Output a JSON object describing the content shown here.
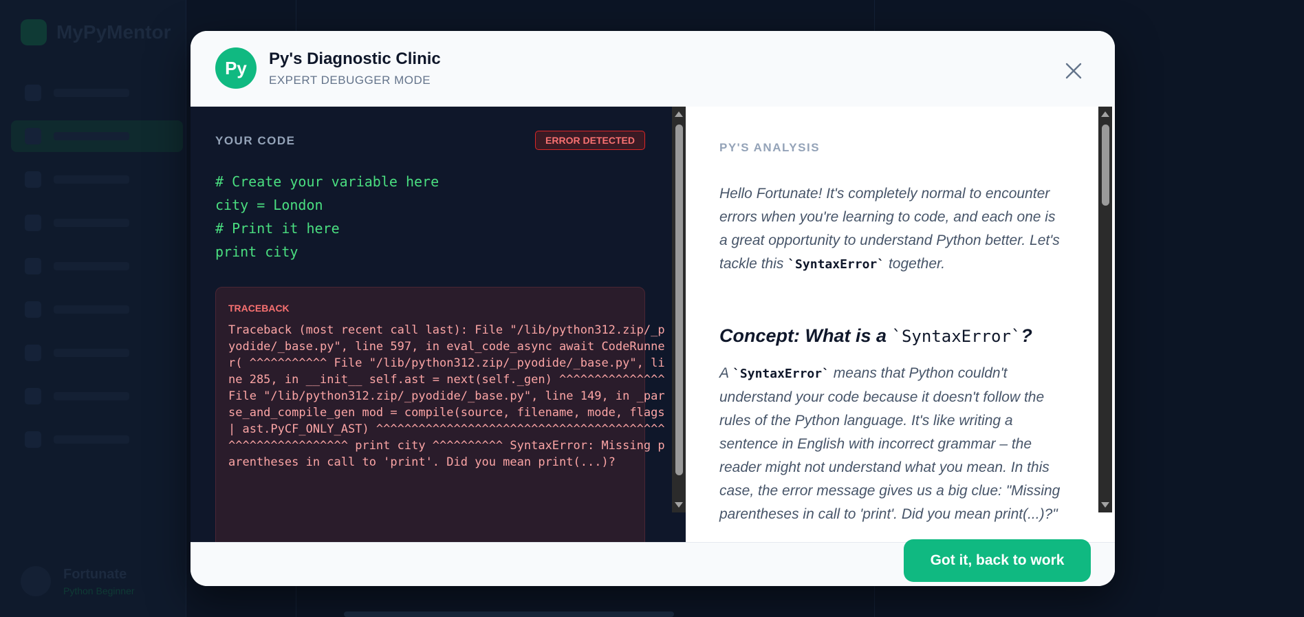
{
  "background": {
    "brand_name": "MyPyMentor",
    "user_name": "Fortunate",
    "user_role": "Python Beginner"
  },
  "modal": {
    "avatar_text": "Py",
    "title": "Py's Diagnostic Clinic",
    "subtitle": "EXPERT DEBUGGER MODE"
  },
  "code_panel": {
    "label": "YOUR CODE",
    "badge": "ERROR DETECTED",
    "lines": [
      "# Create your variable here",
      "city = London",
      "# Print it here",
      "print city"
    ],
    "traceback_label": "TRACEBACK",
    "traceback_text": "Traceback (most recent call last): File \"/lib/python312.zip/_pyodide/_base.py\", line 597, in eval_code_async await CodeRunner( ^^^^^^^^^^^ File \"/lib/python312.zip/_pyodide/_base.py\", line 285, in __init__ self.ast = next(self._gen) ^^^^^^^^^^^^^^^ File \"/lib/python312.zip/_pyodide/_base.py\", line 149, in _parse_and_compile_gen mod = compile(source, filename, mode, flags | ast.PyCF_ONLY_AST) ^^^^^^^^^^^^^^^^^^^^^^^^^^^^^^^^^^^^^^^^^^^^^^^^^^^^^^^^^^ print city ^^^^^^^^^^ SyntaxError: Missing parentheses in call to 'print'. Did you mean print(...)?"
  },
  "analysis": {
    "label": "PY'S ANALYSIS",
    "intro_before": "Hello Fortunate! It's completely normal to encounter errors when you're learning to code, and each one is a great opportunity to understand Python better. Let's tackle this ",
    "intro_code": "`SyntaxError`",
    "intro_after": " together.",
    "heading_before": "Concept: What is a ",
    "heading_code": "`SyntaxError`",
    "heading_after": "?",
    "para_before": "A ",
    "para_code": "`SyntaxError`",
    "para_after": " means that Python couldn't understand your code because it doesn't follow the rules of the Python language. It's like writing a sentence in English with incorrect grammar – the reader might not understand what you mean. In this case, the error message gives us a big clue: \"Missing parentheses in call to 'print'. Did you mean print(...)?\""
  },
  "footer": {
    "button_label": "Got it, back to work"
  },
  "colors": {
    "accent": "#10b981",
    "error": "#f87171"
  }
}
